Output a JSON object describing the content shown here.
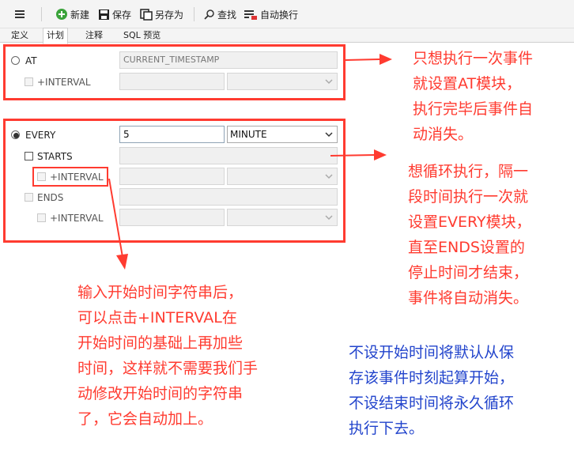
{
  "toolbar": {
    "new_label": "新建",
    "save_label": "保存",
    "save_as_label": "另存为",
    "find_label": "查找",
    "wrap_label": "自动换行"
  },
  "tabs": [
    "定义",
    "计划",
    "注释",
    "SQL 预览"
  ],
  "at_section": {
    "label": "AT",
    "value": "CURRENT_TIMESTAMP",
    "interval_label": "+INTERVAL"
  },
  "every_section": {
    "label": "EVERY",
    "value": "5",
    "unit": "MINUTE",
    "starts_label": "STARTS",
    "starts_interval_label": "+INTERVAL",
    "ends_label": "ENDS",
    "ends_interval_label": "+INTERVAL"
  },
  "annotations": {
    "at_note": [
      "只想执行一次事件",
      "就设置AT模块，",
      "执行完毕后事件自",
      "动消失。"
    ],
    "every_note": [
      "想循环执行，隔一",
      "段时间执行一次就",
      "设置EVERY模块，",
      "直至ENDS设置的",
      "停止时间才结束，",
      "事件将自动消失。"
    ],
    "interval_note": [
      "输入开始时间字符串后，",
      "可以点击+INTERVAL在",
      "开始时间的基础上再加些",
      "时间，这样就不需要我们手",
      "动修改开始时间的字符串",
      "了，它会自动加上。"
    ],
    "default_note": [
      "不设开始时间将默认从保",
      "存该事件时刻起算开始，",
      "不设结束时间将永久循环",
      "执行下去。"
    ]
  },
  "colors": {
    "annotation_red": "#ff3b30",
    "annotation_blue": "#2244cc"
  }
}
